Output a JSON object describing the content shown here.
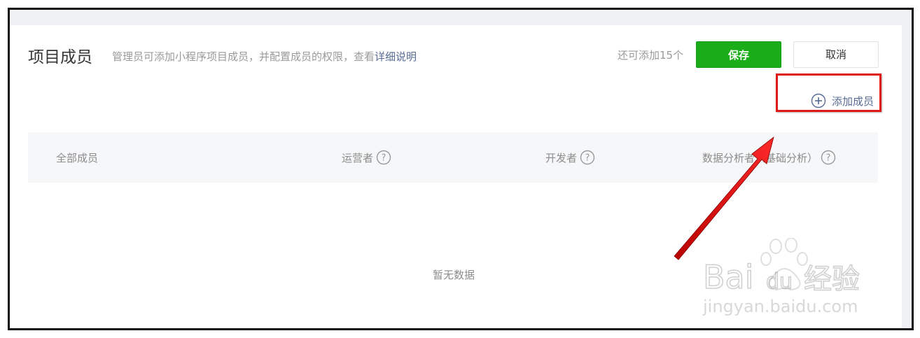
{
  "header": {
    "title": "项目成员",
    "description": "管理员可添加小程序项目成员，并配置成员的权限，查看",
    "help_link": "详细说明",
    "remaining": "还可添加15个",
    "save_label": "保存",
    "cancel_label": "取消"
  },
  "actions": {
    "add_member_label": "添加成员",
    "add_member_icon": "plus-circle-icon"
  },
  "table": {
    "columns": [
      {
        "label": "全部成员",
        "has_help": false
      },
      {
        "label": "运营者",
        "has_help": true
      },
      {
        "label": "开发者",
        "has_help": true
      },
      {
        "label": "数据分析者（基础分析）",
        "has_help": true
      }
    ],
    "empty_text": "暂无数据"
  },
  "watermark": {
    "logo": "Baidu经验",
    "url": "jingyan.baidu.com"
  },
  "colors": {
    "accent_green": "#1aad19",
    "link_blue": "#576b95",
    "highlight_red": "#e01818"
  }
}
